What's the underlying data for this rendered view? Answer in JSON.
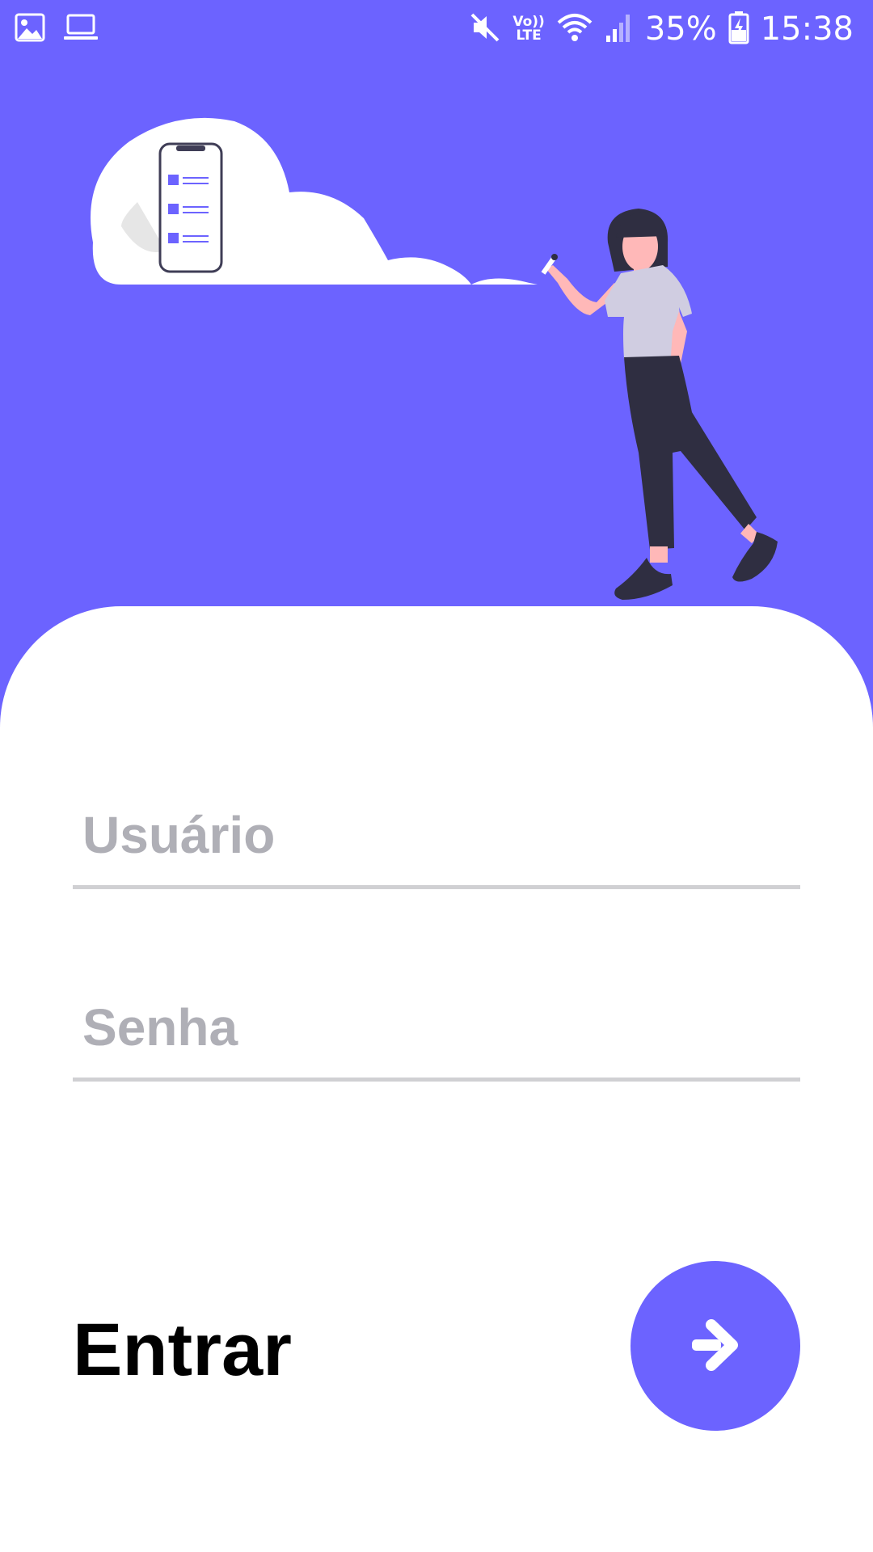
{
  "status_bar": {
    "battery_text": "35%",
    "time": "15:38",
    "volte_line1": "Vo))",
    "volte_line2": "LTE",
    "left_icons": [
      "gallery-icon",
      "laptop-icon"
    ],
    "right_icons": [
      "mute-icon",
      "volte-icon",
      "wifi-icon",
      "signal-icon",
      "battery-charging-icon"
    ]
  },
  "hero": {
    "background_color": "#6c63ff",
    "illustration": "woman-pointing-at-cloud-with-phone-checklist"
  },
  "form": {
    "username_placeholder": "Usuário",
    "password_placeholder": "Senha",
    "submit_label": "Entrar",
    "submit_icon": "arrow-right-icon",
    "accent_color": "#6c63ff"
  }
}
